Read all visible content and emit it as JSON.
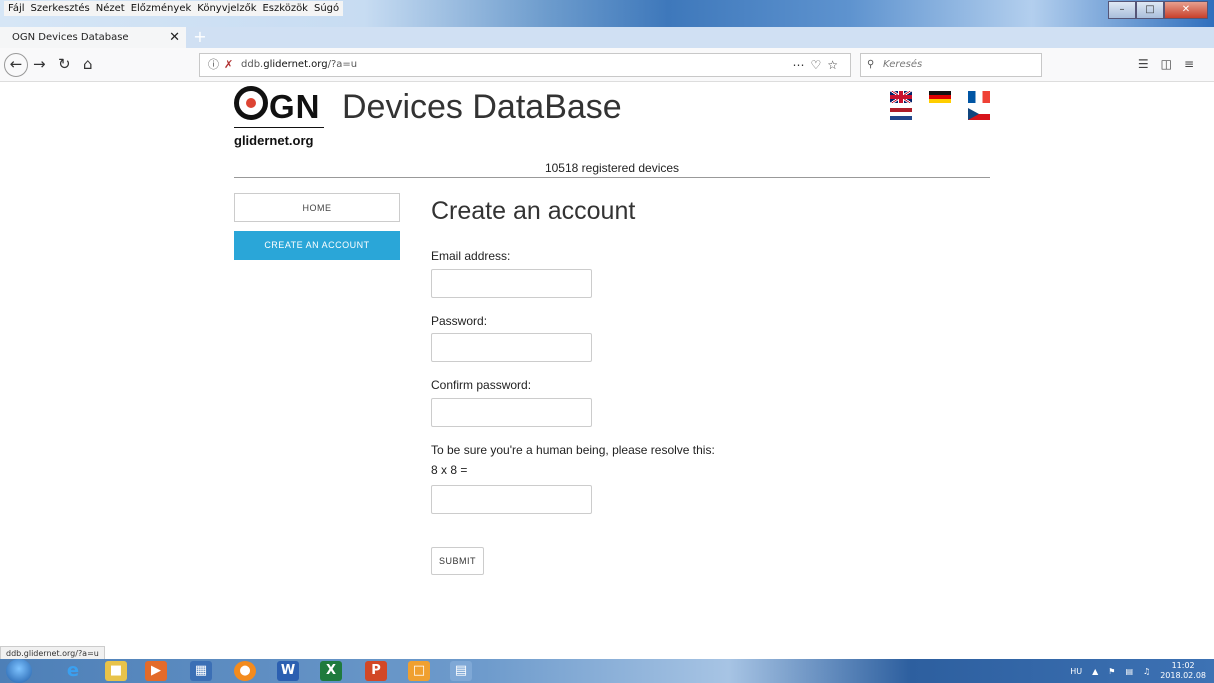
{
  "browser": {
    "menu": [
      "Fájl",
      "Szerkesztés",
      "Nézet",
      "Előzmények",
      "Könyvjelzők",
      "Eszközök",
      "Súgó"
    ],
    "tab_title": "OGN Devices Database",
    "url_prefix": "ddb.",
    "url_domain": "glidernet.org",
    "url_path": "/?a=u",
    "search_placeholder": "Keresés",
    "status_url": "ddb.glidernet.org/?a=u"
  },
  "header": {
    "logo_text": "GN",
    "logo_sub": "glidernet.org",
    "site_title": "Devices DataBase",
    "registered": "10518 registered devices"
  },
  "sidebar": {
    "home": "HOME",
    "create": "CREATE AN ACCOUNT"
  },
  "form": {
    "title": "Create an account",
    "email_label": "Email address:",
    "password_label": "Password:",
    "confirm_label": "Confirm password:",
    "captcha_prompt": "To be sure you're a human being, please resolve this:",
    "captcha_question": "8 x 8 =",
    "submit": "SUBMIT"
  },
  "taskbar": {
    "lang": "HU",
    "time": "11:02",
    "date": "2018.02.08"
  }
}
